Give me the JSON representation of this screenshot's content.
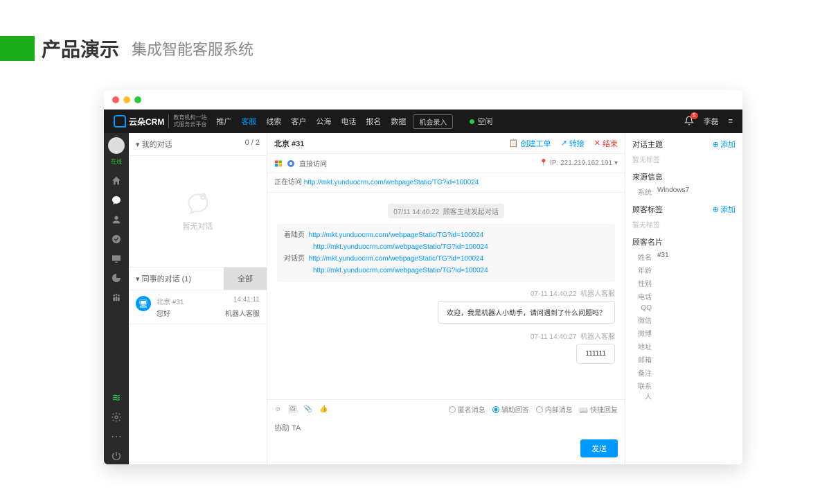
{
  "page": {
    "title": "产品演示",
    "subtitle": "集成智能客服系统"
  },
  "brand": {
    "name": "云朵CRM",
    "sub1": "教育机构一站",
    "sub2": "式服务云平台"
  },
  "nav": {
    "items": [
      "推广",
      "客服",
      "线索",
      "客户",
      "公海",
      "电话",
      "报名",
      "数据"
    ],
    "active": 1,
    "record": "机会录入",
    "idle": "空闲",
    "user": "李磊",
    "badge": "5"
  },
  "iconbar": {
    "online": "在线"
  },
  "convlist": {
    "mine": "我的对话",
    "count": "0 / 2",
    "empty": "暂无对话",
    "peer": "同事的对话 (1)",
    "all": "全部",
    "item": {
      "loc": "北京 #31",
      "time": "14:41:11",
      "msg": "您好",
      "agent": "机器人客服"
    }
  },
  "chat": {
    "title": "北京 #31",
    "actions": {
      "ticket": "创建工单",
      "transfer": "转接",
      "end": "结束"
    },
    "visit": {
      "direct": "直接访问",
      "ip_lbl": "IP:",
      "ip": "221.219.162.191",
      "visiting_lbl": "正在访问",
      "visiting_url": "http://mkt.yunduocrm.com/webpageStatic/TG?id=100024"
    },
    "sys": {
      "ts": "07/11 14:40:22",
      "txt": "顾客主动发起对话"
    },
    "urls": {
      "land_lbl": "着陆页",
      "land1": "http://mkt.yunduocrm.com/webpageStatic/TG?id=100024",
      "land2": "http://mkt.yunduocrm.com/webpageStatic/TG?id=100024",
      "conv_lbl": "对话页",
      "conv1": "http://mkt.yunduocrm.com/webpageStatic/TG?id=100024",
      "conv2": "http://mkt.yunduocrm.com/webpageStatic/TG?id=100024"
    },
    "m1": {
      "ts": "07-11 14:40:22",
      "who": "机器人客服",
      "text": "欢迎，我是机器人小助手，请问遇到了什么问题吗？"
    },
    "m2": {
      "ts": "07-11 14:40:27",
      "who": "机器人客服",
      "text": "111111"
    },
    "opts": {
      "anon": "匿名消息",
      "assist": "辅助回答",
      "internal": "内部消息",
      "quick": "快捷回复"
    },
    "placeholder": "协助 TA",
    "send": "发送"
  },
  "rpanel": {
    "topic": {
      "title": "对话主题",
      "add": "添加",
      "empty": "暂无标签"
    },
    "source": {
      "title": "来源信息",
      "sys_lbl": "系统",
      "sys_val": "Windows7"
    },
    "tags": {
      "title": "顾客标签",
      "add": "添加",
      "empty": "暂无标签"
    },
    "card": {
      "title": "顾客名片",
      "fields": [
        {
          "k": "姓名",
          "v": "#31"
        },
        {
          "k": "年龄",
          "v": ""
        },
        {
          "k": "性别",
          "v": ""
        },
        {
          "k": "电话",
          "v": ""
        },
        {
          "k": "QQ",
          "v": ""
        },
        {
          "k": "微信",
          "v": ""
        },
        {
          "k": "微博",
          "v": ""
        },
        {
          "k": "地址",
          "v": ""
        },
        {
          "k": "邮箱",
          "v": ""
        },
        {
          "k": "备注",
          "v": ""
        },
        {
          "k": "联系人",
          "v": ""
        }
      ]
    }
  }
}
